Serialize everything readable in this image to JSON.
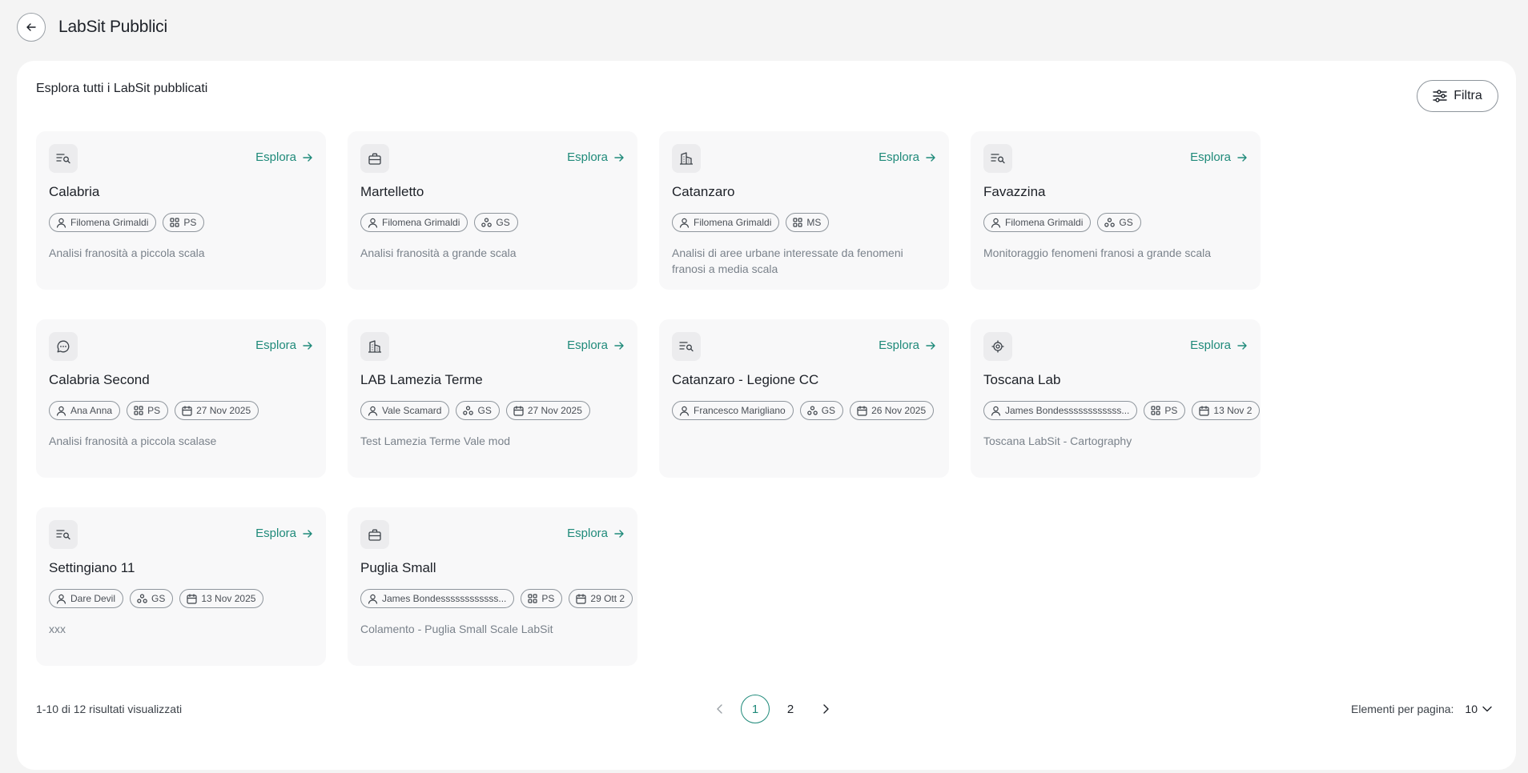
{
  "header": {
    "title": "LabSit Pubblici"
  },
  "panel": {
    "heading": "Esplora tutti i LabSit pubblicati",
    "filter_label": "Filtra"
  },
  "explore_label": "Esplora",
  "cards": [
    {
      "icon": "list-search-icon",
      "title": "Calabria",
      "author": "Filomena Grimaldi",
      "scale_icon": "grid-icon",
      "scale": "PS",
      "date": "",
      "description": "Analisi franosità a piccola scala"
    },
    {
      "icon": "briefcase-icon",
      "title": "Martelletto",
      "author": "Filomena Grimaldi",
      "scale_icon": "nodes-icon",
      "scale": "GS",
      "date": "",
      "description": "Analisi franosità a grande scala"
    },
    {
      "icon": "buildings-icon",
      "title": "Catanzaro",
      "author": "Filomena Grimaldi",
      "scale_icon": "grid-icon",
      "scale": "MS",
      "date": "",
      "description": "Analisi di aree urbane interessate da fenomeni franosi a media scala"
    },
    {
      "icon": "list-search-icon",
      "title": "Favazzina",
      "author": "Filomena Grimaldi",
      "scale_icon": "nodes-icon",
      "scale": "GS",
      "date": "",
      "description": "Monitoraggio fenomeni franosi a grande scala"
    },
    {
      "icon": "chat-icon",
      "title": "Calabria Second",
      "author": "Ana Anna",
      "scale_icon": "grid-icon",
      "scale": "PS",
      "date": "27 Nov 2025",
      "description": "Analisi franosità a piccola scalase"
    },
    {
      "icon": "buildings-icon",
      "title": "LAB Lamezia Terme",
      "author": "Vale Scamard",
      "scale_icon": "nodes-icon",
      "scale": "GS",
      "date": "27 Nov 2025",
      "description": "Test Lamezia Terme Vale mod"
    },
    {
      "icon": "list-search-icon",
      "title": "Catanzaro - Legione CC",
      "author": "Francesco Marigliano",
      "scale_icon": "nodes-icon",
      "scale": "GS",
      "date": "26 Nov 2025",
      "description": ""
    },
    {
      "icon": "target-icon",
      "title": "Toscana Lab",
      "author": "James Bondessssssssssss...",
      "scale_icon": "grid-icon",
      "scale": "PS",
      "date": "13 Nov 2",
      "description": "Toscana LabSit - Cartography"
    },
    {
      "icon": "list-search-icon",
      "title": "Settingiano 11",
      "author": "Dare Devil",
      "scale_icon": "nodes-icon",
      "scale": "GS",
      "date": "13 Nov 2025",
      "description": "xxx"
    },
    {
      "icon": "briefcase-icon",
      "title": "Puglia Small",
      "author": "James Bondessssssssssss...",
      "scale_icon": "grid-icon",
      "scale": "PS",
      "date": "29 Ott 2",
      "description": "Colamento - Puglia Small Scale LabSit"
    }
  ],
  "footer": {
    "result_count": "1-10 di 12 risultati visualizzati",
    "pages": [
      "1",
      "2"
    ],
    "current_page": "1",
    "per_page_label": "Elementi per pagina:",
    "per_page_value": "10"
  },
  "colors": {
    "accent": "#1f8a7a",
    "background": "#f4f4f4",
    "card": "#f8f8f9"
  }
}
